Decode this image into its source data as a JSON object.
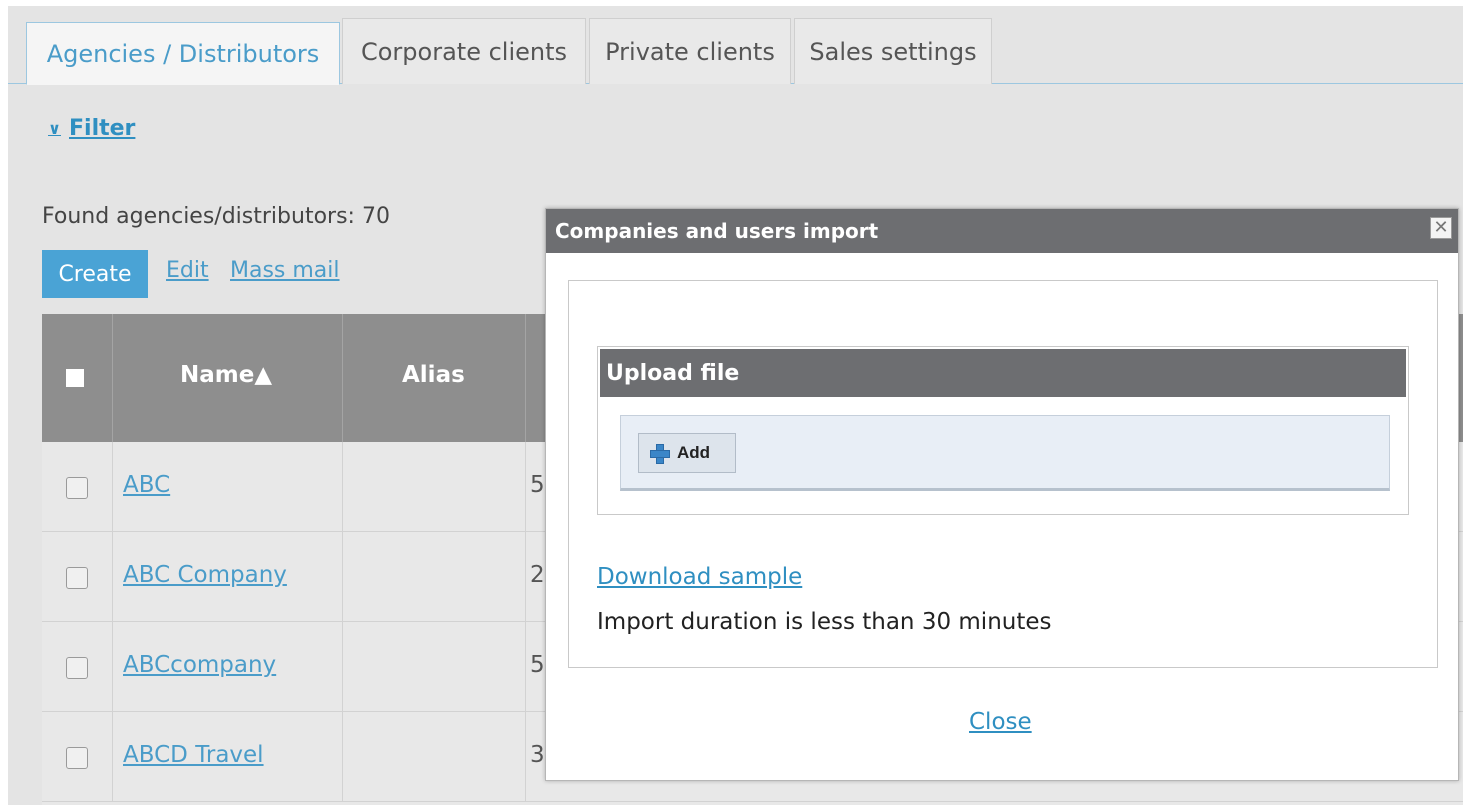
{
  "tabs": [
    {
      "label": "Agencies / Distributors",
      "active": true
    },
    {
      "label": "Corporate clients",
      "active": false
    },
    {
      "label": "Private clients",
      "active": false
    },
    {
      "label": "Sales settings",
      "active": false
    }
  ],
  "filter": {
    "label": "Filter",
    "icon": "chevron-down-icon"
  },
  "found_text": "Found agencies/distributors: 70",
  "actions": {
    "create": "Create",
    "edit": "Edit",
    "mass_mail": "Mass mail"
  },
  "table": {
    "headers": {
      "name": "Name▲",
      "alias": "Alias"
    },
    "rows": [
      {
        "name": "ABC",
        "partial": "5"
      },
      {
        "name": "ABC Company",
        "partial": "2"
      },
      {
        "name": "ABCcompany",
        "partial": "5"
      },
      {
        "name": "ABCD Travel",
        "partial": "3"
      }
    ]
  },
  "modal": {
    "title": "Companies and users import",
    "close_icon": "✕",
    "upload_title": "Upload file",
    "add_label": "Add",
    "download_sample": "Download sample",
    "duration_text": "Import duration is less than 30 minutes",
    "close_label": "Close"
  },
  "colors": {
    "accent": "#4aa3d5",
    "link": "#2f8fc1",
    "header_gray": "#6d6e71",
    "table_header": "#8e8e8e"
  }
}
